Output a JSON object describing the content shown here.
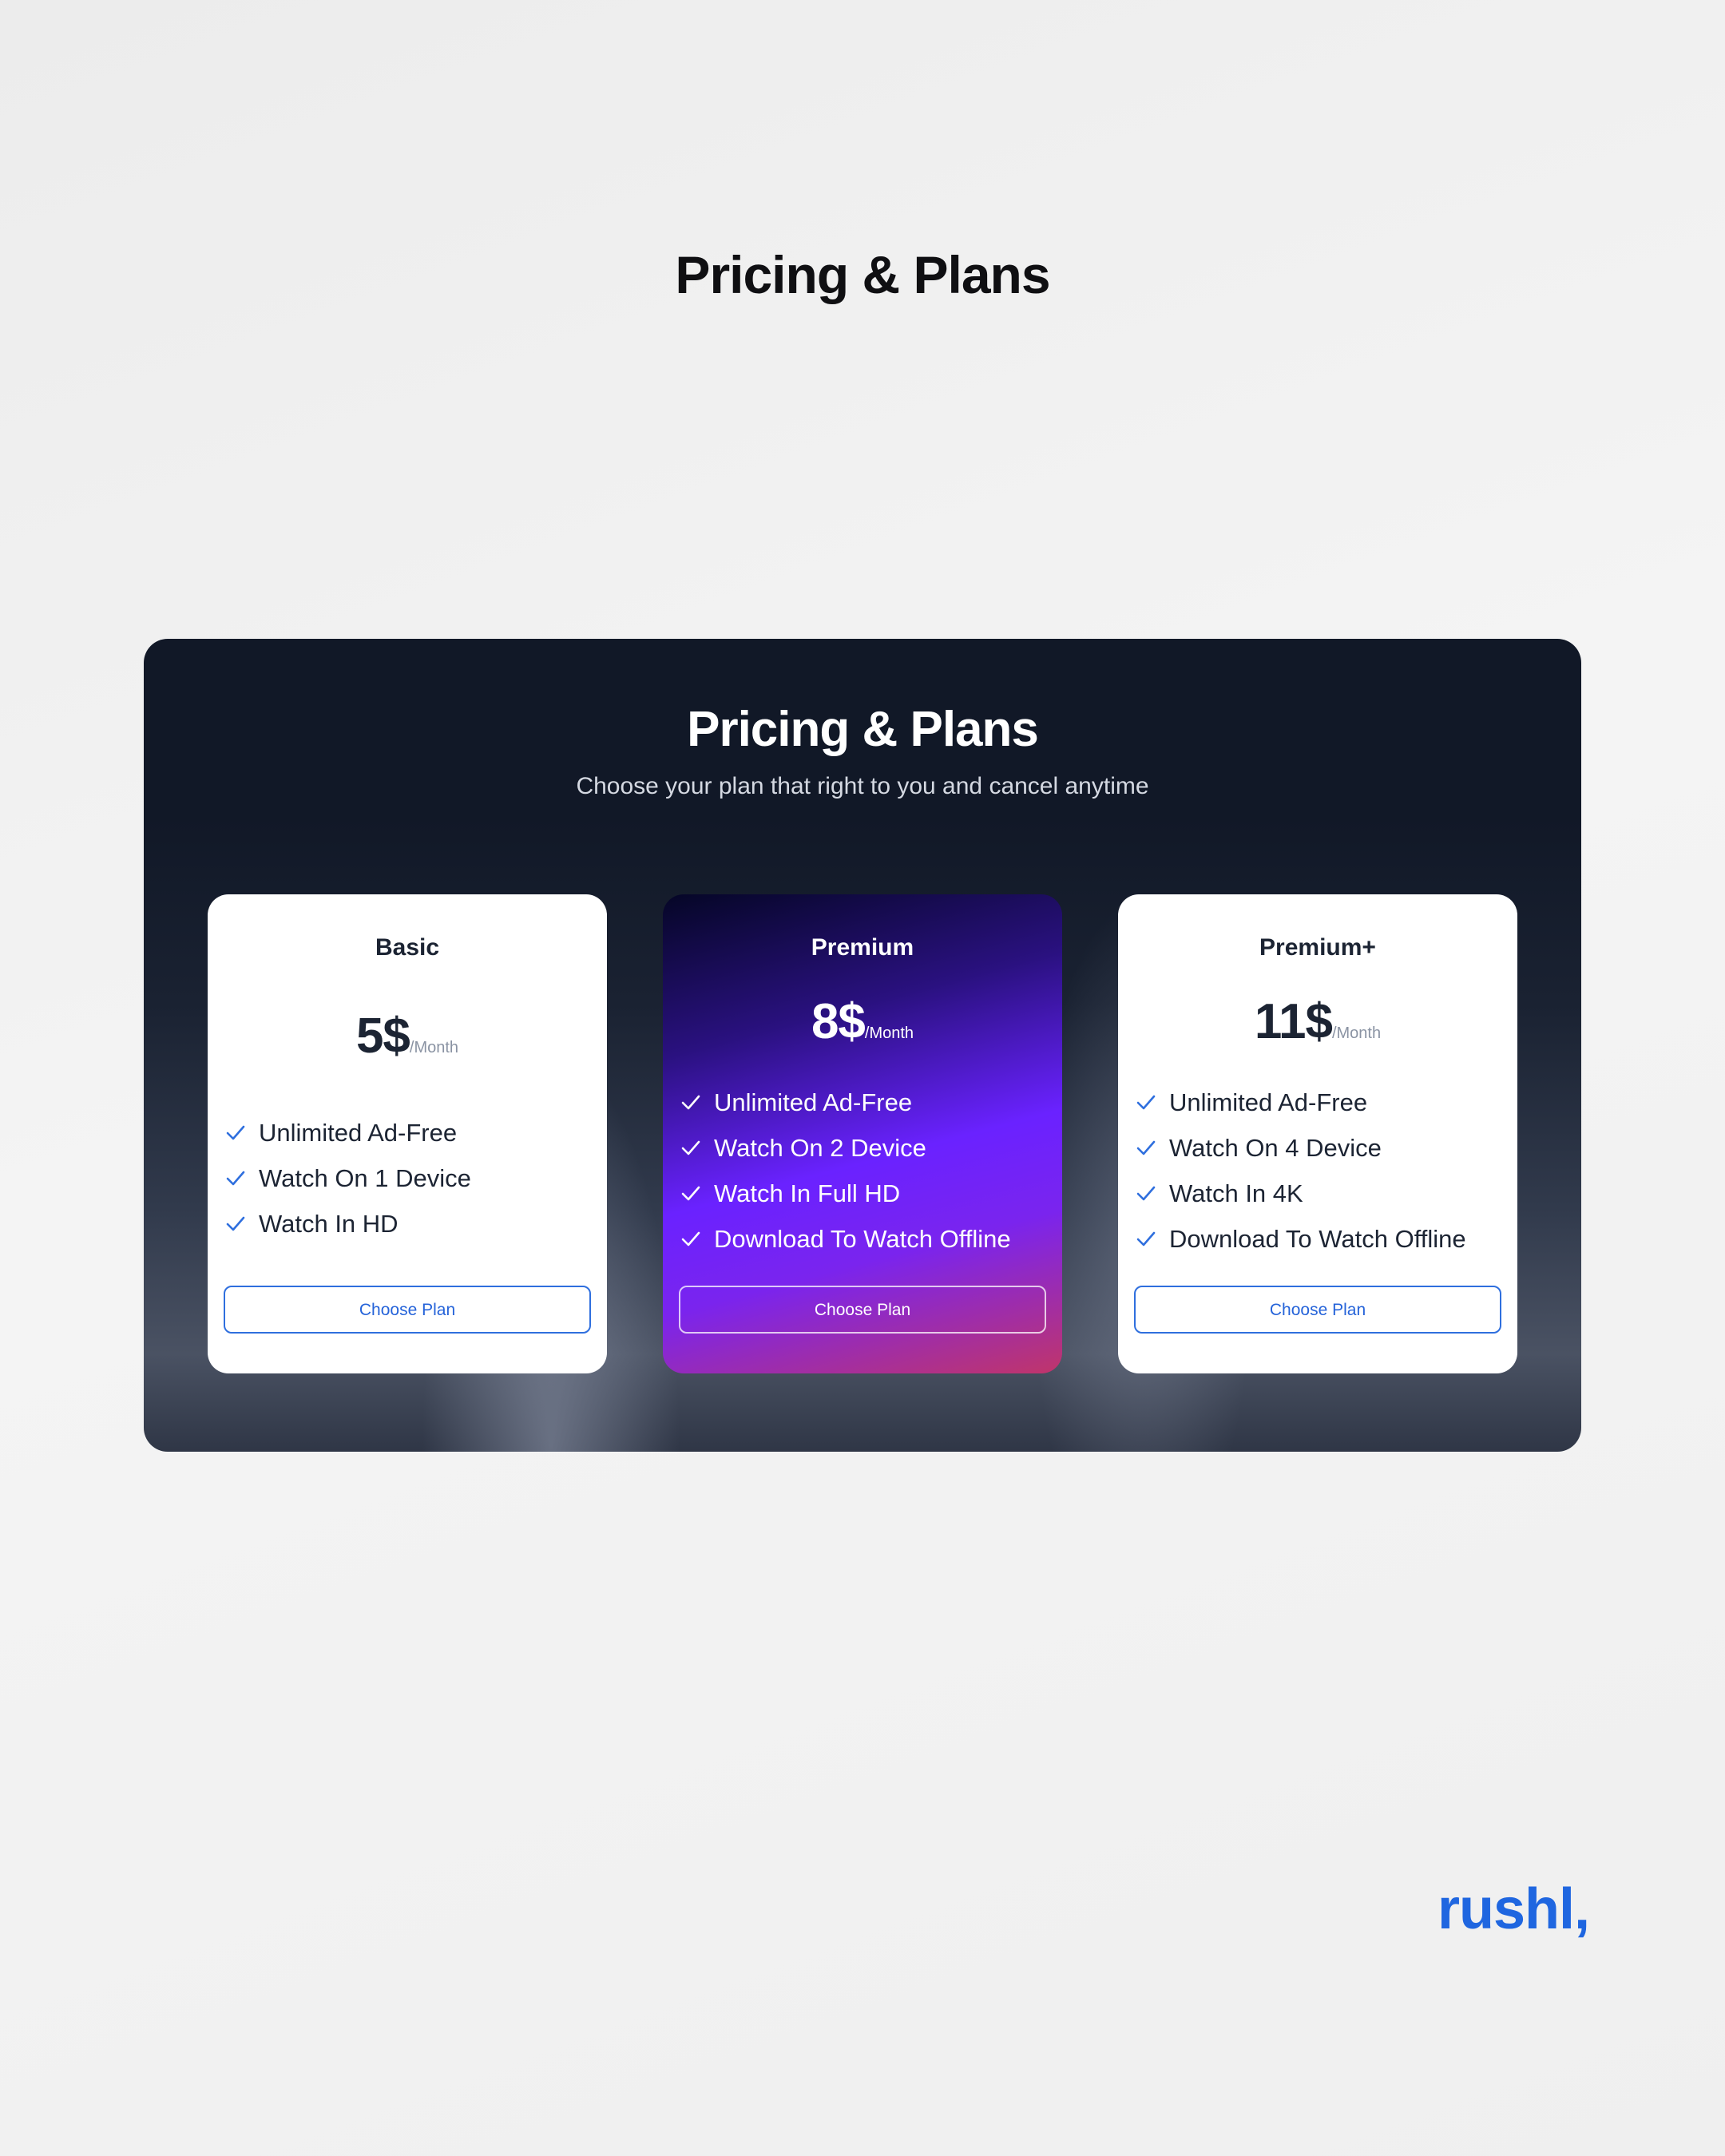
{
  "page": {
    "heading": "Pricing & Plans"
  },
  "panel": {
    "title": "Pricing & Plans",
    "subtitle": "Choose your plan that right to you and cancel anytime"
  },
  "plans": [
    {
      "name": "Basic",
      "price": "5$",
      "period": "/Month",
      "features": [
        "Unlimited Ad-Free",
        "Watch On 1 Device",
        "Watch In HD"
      ],
      "button_label": "Choose Plan"
    },
    {
      "name": "Premium",
      "price": "8$",
      "period": "/Month",
      "features": [
        "Unlimited Ad-Free",
        "Watch On 2 Device",
        "Watch In Full HD",
        "Download To Watch Offline"
      ],
      "button_label": "Choose Plan"
    },
    {
      "name": "Premium+",
      "price": "11$",
      "period": "/Month",
      "features": [
        "Unlimited Ad-Free",
        "Watch On 4 Device",
        "Watch In 4K",
        "Download To Watch Offline"
      ],
      "button_label": "Choose Plan"
    }
  ],
  "brand": {
    "logo_text": "rushl,"
  },
  "icons": {
    "feature_bullet": "check-icon"
  },
  "colors": {
    "accent_blue": "#2563d9",
    "panel_dark": "#111827",
    "premium_purple": "#6a22ff",
    "premium_pink": "#c0356a"
  }
}
